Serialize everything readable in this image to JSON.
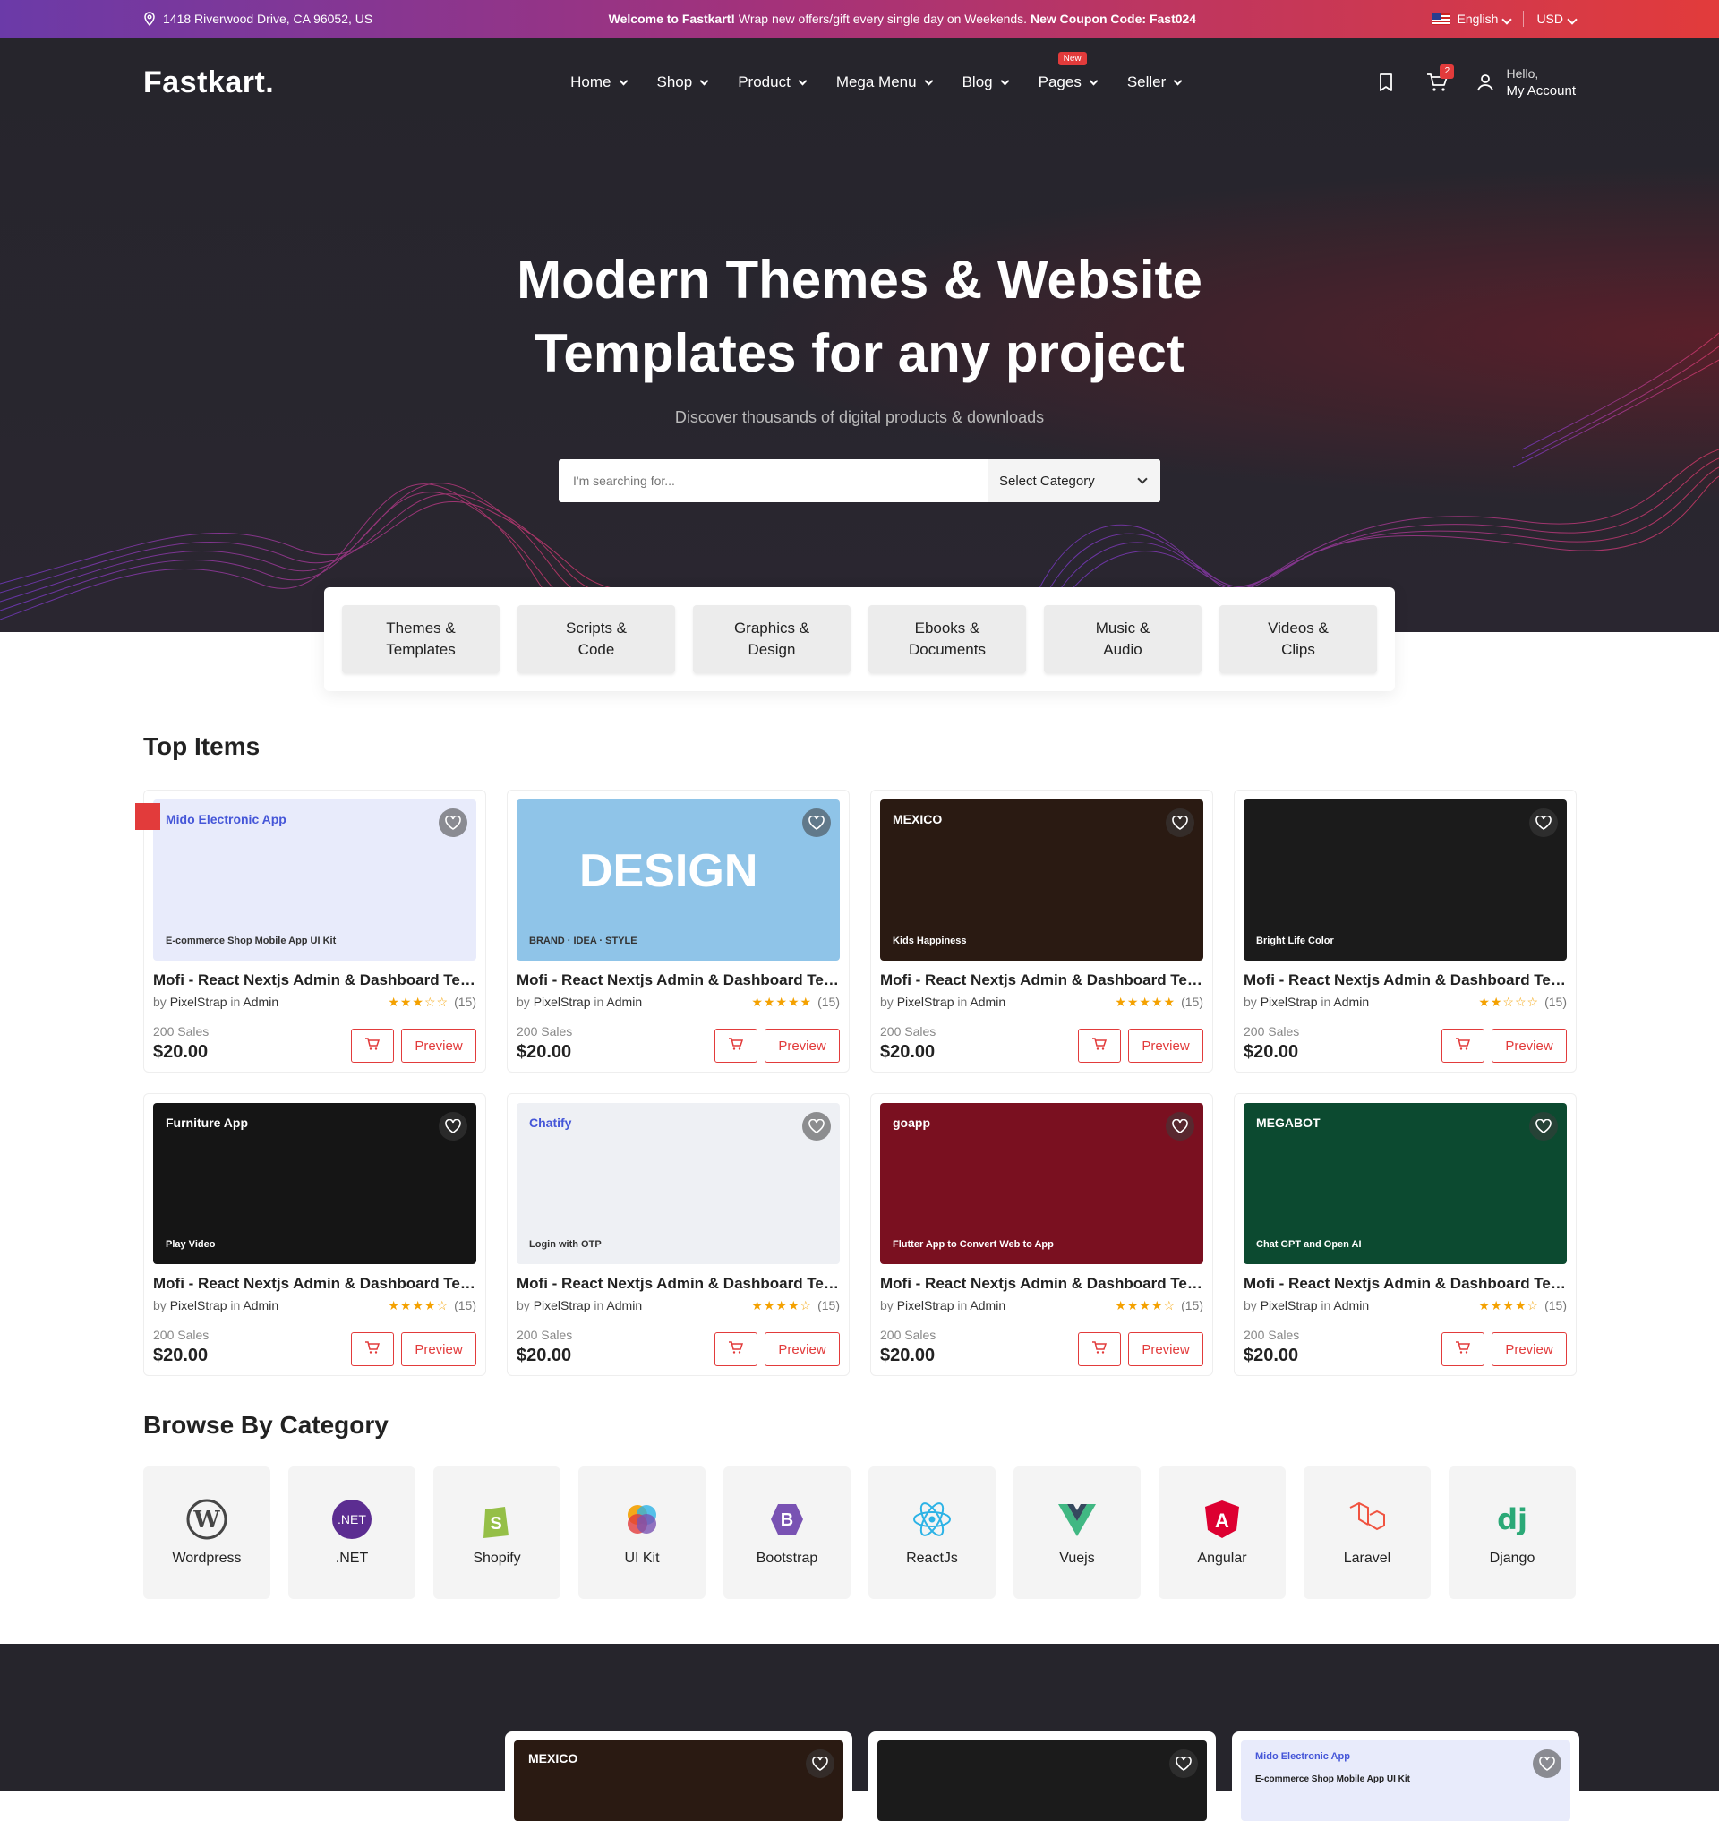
{
  "topbar": {
    "address": "1418 Riverwood Drive, CA 96052, US",
    "welcome_bold": "Welcome to Fastkart!",
    "welcome_text": " Wrap new offers/gift every single day on Weekends. ",
    "coupon": "New Coupon Code: Fast024",
    "language": "English",
    "currency": "USD"
  },
  "header": {
    "logo": "Fastkart.",
    "menu": [
      "Home",
      "Shop",
      "Product",
      "Mega Menu",
      "Blog",
      "Pages",
      "Seller"
    ],
    "new_badge": "New",
    "cart_count": "2",
    "hello": "Hello,",
    "account": "My Account"
  },
  "hero": {
    "title_line1": "Modern Themes & Website",
    "title_line2": "Templates for any project",
    "subtitle": "Discover thousands of digital products & downloads",
    "search_placeholder": "I'm searching for...",
    "category_select": "Select Category"
  },
  "category_tabs": [
    {
      "l1": "Themes &",
      "l2": "Templates"
    },
    {
      "l1": "Scripts &",
      "l2": "Code"
    },
    {
      "l1": "Graphics &",
      "l2": "Design"
    },
    {
      "l1": "Ebooks &",
      "l2": "Documents"
    },
    {
      "l1": "Music &",
      "l2": "Audio"
    },
    {
      "l1": "Videos &",
      "l2": "Clips"
    }
  ],
  "top_items": {
    "title": "Top Items",
    "products": [
      {
        "title": "Mofi - React Nextjs Admin & Dashboard Templ...",
        "by": "by",
        "author": "PixelStrap",
        "in": "in",
        "category": "Admin",
        "stars": "★★★☆☆",
        "reviews": "(15)",
        "sales": "200 Sales",
        "price": "$20.00",
        "preview": "Preview",
        "thumb_color": "#e8ebfb",
        "thumb_label": "Mido Electronic App",
        "thumb_sub": "E-commerce Shop Mobile App UI Kit"
      },
      {
        "title": "Mofi - React Nextjs Admin & Dashboard Templ...",
        "by": "by",
        "author": "PixelStrap",
        "in": "in",
        "category": "Admin",
        "stars": "★★★★★",
        "reviews": "(15)",
        "sales": "200 Sales",
        "price": "$20.00",
        "preview": "Preview",
        "thumb_color": "#8fc4e8",
        "thumb_label": "DESIGN",
        "thumb_sub": "BRAND · IDEA · STYLE"
      },
      {
        "title": "Mofi - React Nextjs Admin & Dashboard Templ...",
        "by": "by",
        "author": "PixelStrap",
        "in": "in",
        "category": "Admin",
        "stars": "★★★★★",
        "reviews": "(15)",
        "sales": "200 Sales",
        "price": "$20.00",
        "preview": "Preview",
        "thumb_color": "#2a1a12",
        "thumb_label": "MEXICO",
        "thumb_sub": "Kids Happiness"
      },
      {
        "title": "Mofi - React Nextjs Admin & Dashboard Templ...",
        "by": "by",
        "author": "PixelStrap",
        "in": "in",
        "category": "Admin",
        "stars": "★★☆☆☆",
        "reviews": "(15)",
        "sales": "200 Sales",
        "price": "$20.00",
        "preview": "Preview",
        "thumb_color": "#1b1b1b",
        "thumb_label": "",
        "thumb_sub": "Bright Life Color"
      },
      {
        "title": "Mofi - React Nextjs Admin & Dashboard Templ...",
        "by": "by",
        "author": "PixelStrap",
        "in": "in",
        "category": "Admin",
        "stars": "★★★★☆",
        "reviews": "(15)",
        "sales": "200 Sales",
        "price": "$20.00",
        "preview": "Preview",
        "thumb_color": "#151515",
        "thumb_label": "Furniture App",
        "thumb_sub": "Play Video"
      },
      {
        "title": "Mofi - React Nextjs Admin & Dashboard Templ...",
        "by": "by",
        "author": "PixelStrap",
        "in": "in",
        "category": "Admin",
        "stars": "★★★★☆",
        "reviews": "(15)",
        "sales": "200 Sales",
        "price": "$20.00",
        "preview": "Preview",
        "thumb_color": "#eef0f4",
        "thumb_label": "Chatify",
        "thumb_sub": "Login with OTP"
      },
      {
        "title": "Mofi - React Nextjs Admin & Dashboard Templ...",
        "by": "by",
        "author": "PixelStrap",
        "in": "in",
        "category": "Admin",
        "stars": "★★★★☆",
        "reviews": "(15)",
        "sales": "200 Sales",
        "price": "$20.00",
        "preview": "Preview",
        "thumb_color": "#7a1020",
        "thumb_label": "goapp",
        "thumb_sub": "Flutter App to Convert Web to App"
      },
      {
        "title": "Mofi - React Nextjs Admin & Dashboard Templ...",
        "by": "by",
        "author": "PixelStrap",
        "in": "in",
        "category": "Admin",
        "stars": "★★★★☆",
        "reviews": "(15)",
        "sales": "200 Sales",
        "price": "$20.00",
        "preview": "Preview",
        "thumb_color": "#0c4a30",
        "thumb_label": "MEGABOT",
        "thumb_sub": "Chat GPT and Open AI"
      }
    ]
  },
  "browse": {
    "title": "Browse By Category",
    "items": [
      {
        "label": "Wordpress",
        "icon": "wordpress-icon",
        "color": "#464646"
      },
      {
        "label": ".NET",
        "icon": "dotnet-icon",
        "color": "#5c2d91"
      },
      {
        "label": "Shopify",
        "icon": "shopify-icon",
        "color": "#95bf47"
      },
      {
        "label": "UI Kit",
        "icon": "uikit-icon",
        "color": "#f4a100"
      },
      {
        "label": "Bootstrap",
        "icon": "bootstrap-icon",
        "color": "#7952b3"
      },
      {
        "label": "ReactJs",
        "icon": "react-icon",
        "color": "#2db3e6"
      },
      {
        "label": "Vuejs",
        "icon": "vue-icon",
        "color": "#41b883"
      },
      {
        "label": "Angular",
        "icon": "angular-icon",
        "color": "#dd0031"
      },
      {
        "label": "Laravel",
        "icon": "laravel-icon",
        "color": "#f05340"
      },
      {
        "label": "Django",
        "icon": "django-icon",
        "color": "#2ba977"
      }
    ]
  },
  "bottom_cards": [
    {
      "thumb_color": "#2a1a12",
      "label": "MEXICO"
    },
    {
      "thumb_color": "#1b1b1b",
      "label": ""
    },
    {
      "thumb_color": "#e8ebfb",
      "label": "Mido Electronic App",
      "sub": "E-commerce Shop Mobile App UI Kit"
    }
  ]
}
